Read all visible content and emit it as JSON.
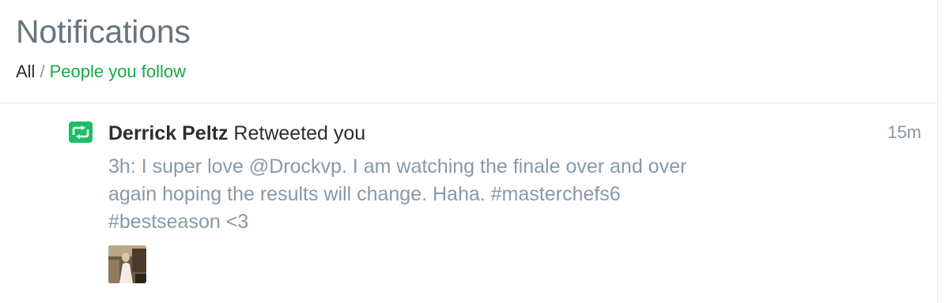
{
  "header": {
    "title": "Notifications",
    "filters": {
      "all_label": "All",
      "separator": "/",
      "following_label": "People you follow"
    }
  },
  "notification": {
    "icon": "retweet-icon",
    "actor_name": "Derrick Peltz",
    "action_text": "Retweeted you",
    "time_ago": "15m",
    "tweet_lines": [
      "3h: I super love @Drockvp. I am watching the finale over and over",
      "again hoping the results will change. Haha. #masterchefs6",
      "#bestseason <3"
    ],
    "media_thumbnail": "photo-thumbnail"
  },
  "colors": {
    "title_gray": "#66757f",
    "muted_gray": "#8899a6",
    "text_dark": "#292f33",
    "filter_green": "#19a84a",
    "retweet_green": "#19bf64",
    "divider": "#e1e8ed"
  }
}
